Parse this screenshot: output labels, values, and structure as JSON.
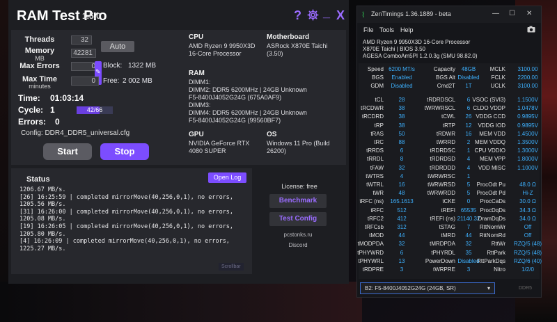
{
  "rtp": {
    "app_name": "RAM Test Pro",
    "version": "1.5.0",
    "help_symbol": "?",
    "min_symbol": "_",
    "close_symbol": "X",
    "threads_label": "Threads",
    "threads_value": "32",
    "memory_label": "Memory",
    "memory_unit": "MB",
    "memory_value": "42281",
    "auto_label": "Auto",
    "max_errors_label": "Max Errors",
    "max_errors_value": "0",
    "max_time_label": "Max Time",
    "max_time_unit": "minutes",
    "max_time_value": "0",
    "block_label": "Block:",
    "block_value": "1322 MB",
    "free_label": "Free:",
    "free_value": "2 002 MB",
    "time_label": "Time:",
    "time_value": "01:03:14",
    "cycle_label": "Cycle:",
    "cycle_value": "1",
    "cycle_progress_text": "42/66",
    "cycle_progress_fraction": 0.636,
    "errors_label": "Errors:",
    "errors_value": "0",
    "config_text": "Config: DDR4_DDR5_universal.cfg",
    "start_label": "Start",
    "stop_label": "Stop",
    "cpu_h": "CPU",
    "cpu_text": "AMD Ryzen 9 9950X3D\n16-Core Processor",
    "mb_h": "Motherboard",
    "mb_text": "ASRock X870E Taichi\n(3.50)",
    "ram_h": "RAM",
    "ram_text": "DIMM1:\nDIMM2: DDR5 6200MHz | 24GB Unknown\nF5-8400J4052G24G (675A0AF9)\nDIMM3:\nDIMM4: DDR5 6200MHz | 24GB Unknown\nF5-8400J4052G24G (99560BF7)",
    "gpu_h": "GPU",
    "gpu_text": "NVIDIA GeForce RTX\n4080 SUPER",
    "os_h": "OS",
    "os_text": "Windows 11 Pro (Build\n26200)",
    "status_h": "Status",
    "open_log": "Open Log",
    "log": "1206.67 MB/s.\n[26] 16:25:59 | completed mirrorMove(40,256,0,1), no errors,\n1205.56 MB/s.\n[31] 16:26:00 | completed mirrorMove(40,256,0,1), no errors,\n1205.08 MB/s.\n[19] 16:26:05 | completed mirrorMove(40,256,0,1), no errors,\n1205.80 MB/s.\n[4] 16:26:09 | completed mirrorMove(40,256,0,1), no errors,\n1225.27 MB/s.",
    "scrollbar": "Scrollbar",
    "license": "License: free",
    "benchmark": "Benchmark",
    "test_config": "Test Config",
    "site": "pcstonks.ru",
    "discord": "Discord",
    "accent": "#7c4dff"
  },
  "zt": {
    "title": "ZenTimings 1.36.1889 - beta",
    "min_symbol": "—",
    "max_symbol": "☐",
    "close_symbol": "✕",
    "menu": [
      "File",
      "Tools",
      "Help"
    ],
    "cpu": "AMD Ryzen 9 9950X3D 16-Core Processor",
    "board": "X870E Taichi | BIOS 3.50",
    "agesa": "AGESA ComboAm5PI 1.2.0.3g (SMU 98.82.0)",
    "row1": [
      {
        "l": "Speed",
        "v": "6200 MT/s",
        "c": "#3db1ff"
      },
      {
        "l": "Capacity",
        "v": "48GB",
        "c": "#3db1ff"
      },
      {
        "l": "MCLK",
        "v": "3100.00",
        "c": "#3db1ff"
      }
    ],
    "row2": [
      {
        "l": "BGS",
        "v": "Enabled",
        "c": "#3db1ff"
      },
      {
        "l": "BGS Alt",
        "v": "Disabled",
        "c": "#3db1ff"
      },
      {
        "l": "FCLK",
        "v": "2200.00",
        "c": "#3db1ff"
      }
    ],
    "row3": [
      {
        "l": "GDM",
        "v": "Disabled",
        "c": "#3db1ff"
      },
      {
        "l": "Cmd2T",
        "v": "1T",
        "c": "#3db1ff"
      },
      {
        "l": "UCLK",
        "v": "3100.00",
        "c": "#3db1ff"
      }
    ],
    "timings": [
      [
        "tCL",
        "28",
        "tRDRDSCL",
        "6",
        "VSOC (SVI3)",
        "1.1500V"
      ],
      [
        "tRCDWR",
        "38",
        "tWRWRSCL",
        "6",
        "CLDO VDDP",
        "1.0478V"
      ],
      [
        "tRCDRD",
        "38",
        "tCWL",
        "26",
        "VDDG CCD",
        "0.9895V"
      ],
      [
        "tRP",
        "38",
        "tRTP",
        "12",
        "VDDG IOD",
        "0.9895V"
      ],
      [
        "tRAS",
        "50",
        "tRDWR",
        "16",
        "MEM VDD",
        "1.4500V"
      ],
      [
        "tRC",
        "88",
        "tWRRD",
        "2",
        "MEM VDDQ",
        "1.3500V"
      ],
      [
        "tRRDS",
        "6",
        "tRDRDSC",
        "1",
        "CPU VDDIO",
        "1.3000V"
      ],
      [
        "tRRDL",
        "8",
        "tRDRDSD",
        "4",
        "MEM VPP",
        "1.8000V"
      ],
      [
        "tFAW",
        "32",
        "tRDRDDD",
        "4",
        "VDD MISC",
        "1.1000V"
      ],
      [
        "tWTRS",
        "4",
        "tWRWRSC",
        "1",
        "",
        ""
      ],
      [
        "tWTRL",
        "16",
        "tWRWRSD",
        "5",
        "ProcOdt Pu",
        "48.0 Ω"
      ],
      [
        "tWR",
        "48",
        "tWRWRDD",
        "5",
        "ProcOdt Pd",
        "Hi-Z"
      ],
      [
        "tRFC (ns)",
        "165.1613",
        "tCKE",
        "0",
        "ProcCaDs",
        "30.0 Ω"
      ],
      [
        "tRFC",
        "512",
        "tREFI",
        "65535",
        "ProcDqDs",
        "34.3 Ω"
      ],
      [
        "tRFC2",
        "412",
        "tREFI (ns)",
        "21140.32",
        "DramDqDs",
        "34.0 Ω"
      ],
      [
        "tRFCsb",
        "312",
        "tSTAG",
        "7",
        "RttNomWr",
        "Off"
      ],
      [
        "tMOD",
        "44",
        "tMRD",
        "44",
        "RttNomRd",
        "Off"
      ],
      [
        "tMODPDA",
        "32",
        "tMRDPDA",
        "32",
        "RttWr",
        "RZQ/5 (48)"
      ],
      [
        "tPHYWRD",
        "6",
        "tPHYRDL",
        "35",
        "RttPark",
        "RZQ/5 (48)"
      ],
      [
        "tPHYWRL",
        "13",
        "PowerDown",
        "Disabled",
        "RttParkDqs",
        "RZQ/6 (40)"
      ],
      [
        "tRDPRE",
        "3",
        "tWRPRE",
        "3",
        "Nitro",
        "1/2/0"
      ]
    ],
    "dimm_select": "B2:  F5-8400J4052G24G (24GB, SR)",
    "ddr": "DDR5",
    "value_color": "#3db1ff",
    "logo_color": "#30c050"
  }
}
